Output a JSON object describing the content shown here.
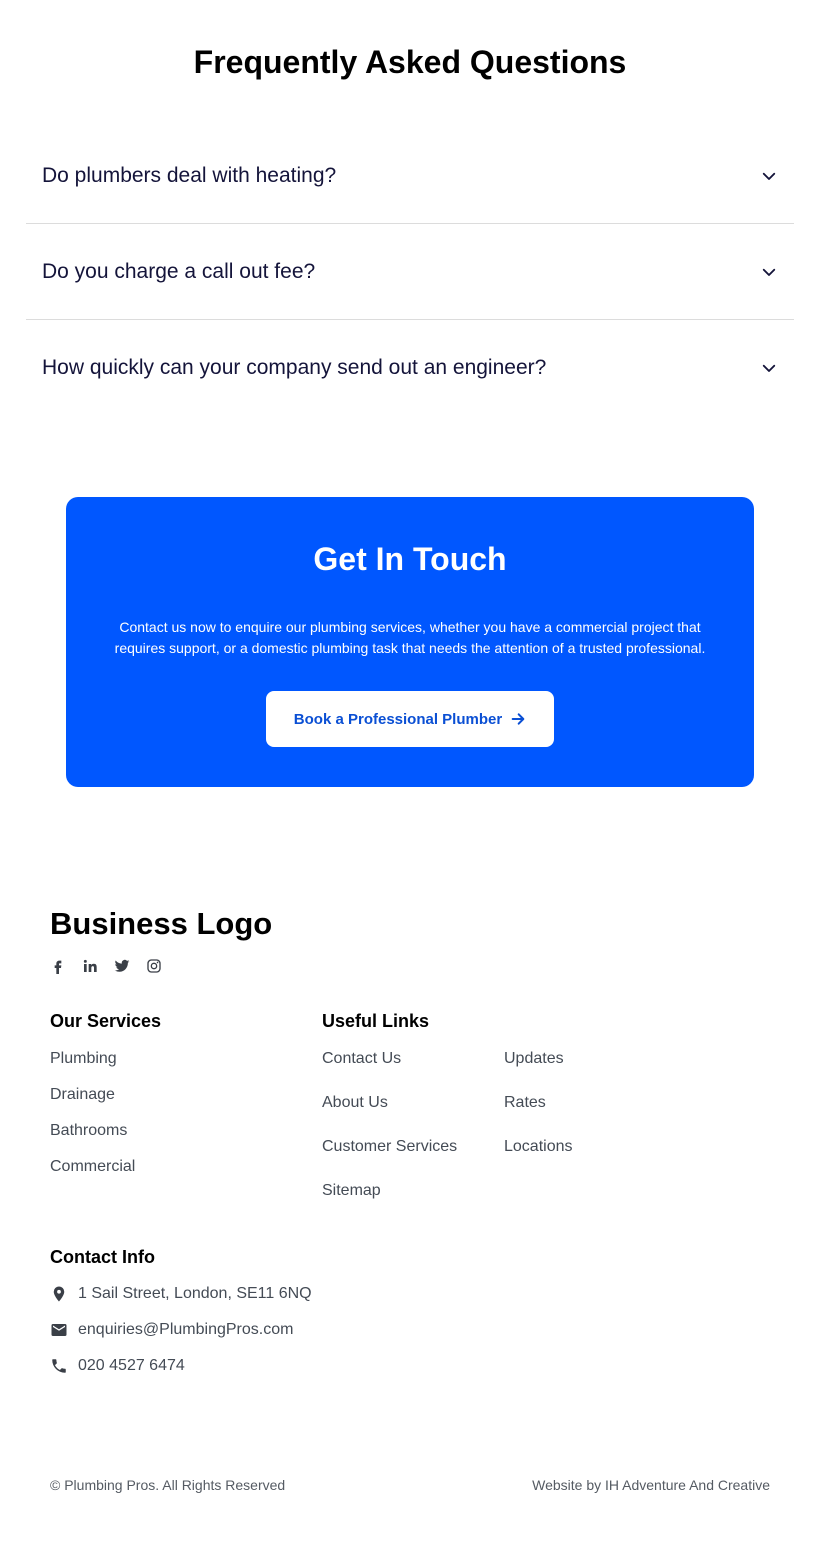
{
  "faq": {
    "title": "Frequently Asked Questions",
    "items": [
      {
        "question": "Do plumbers deal with heating?"
      },
      {
        "question": "Do you charge a call out fee?"
      },
      {
        "question": "How quickly can your company send out an engineer?"
      }
    ]
  },
  "cta": {
    "title": "Get In Touch",
    "text": "Contact us now to enquire our plumbing services, whether you have a commercial project that requires support, or a domestic plumbing task that needs the attention of a trusted professional.",
    "button_label": "Book a Professional Plumber",
    "background_color": "#0057ff"
  },
  "footer": {
    "brand": "Business Logo",
    "socials": [
      "facebook-icon",
      "linkedin-icon",
      "twitter-icon",
      "instagram-icon"
    ],
    "services": {
      "heading": "Our Services",
      "items": [
        "Plumbing",
        "Drainage",
        "Bathrooms",
        "Commercial"
      ]
    },
    "useful_links": {
      "heading": "Useful Links",
      "col1": [
        "Contact Us",
        "About Us",
        "Customer Services",
        "Sitemap"
      ],
      "col2": [
        "Updates",
        "Rates",
        "Locations"
      ]
    },
    "contact": {
      "heading": "Contact Info",
      "address": "1 Sail Street, London, SE11 6NQ",
      "email": "enquiries@PlumbingPros.com",
      "phone": "020 4527 6474"
    },
    "copyright": "© Plumbing Pros. All Rights Reserved",
    "credit": "Website by IH Adventure And Creative"
  }
}
